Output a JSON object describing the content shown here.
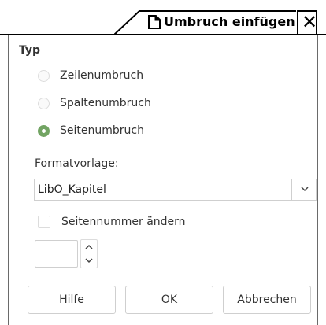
{
  "window": {
    "title": "Umbruch einfügen",
    "close_glyph": "✕"
  },
  "type_section": {
    "label": "Typ",
    "options": [
      {
        "label": "Zeilenumbruch",
        "checked": false
      },
      {
        "label": "Spaltenumbruch",
        "checked": false
      },
      {
        "label": "Seitenumbruch",
        "checked": true
      }
    ]
  },
  "style": {
    "label": "Formatvorlage:",
    "selected": "LibO_Kapitel"
  },
  "page_number": {
    "checkbox_label": "Seitennummer ändern",
    "checked": false,
    "value": ""
  },
  "buttons": {
    "help": "Hilfe",
    "ok": "OK",
    "cancel": "Abbrechen"
  },
  "colors": {
    "radio_checked": "#72a463"
  }
}
